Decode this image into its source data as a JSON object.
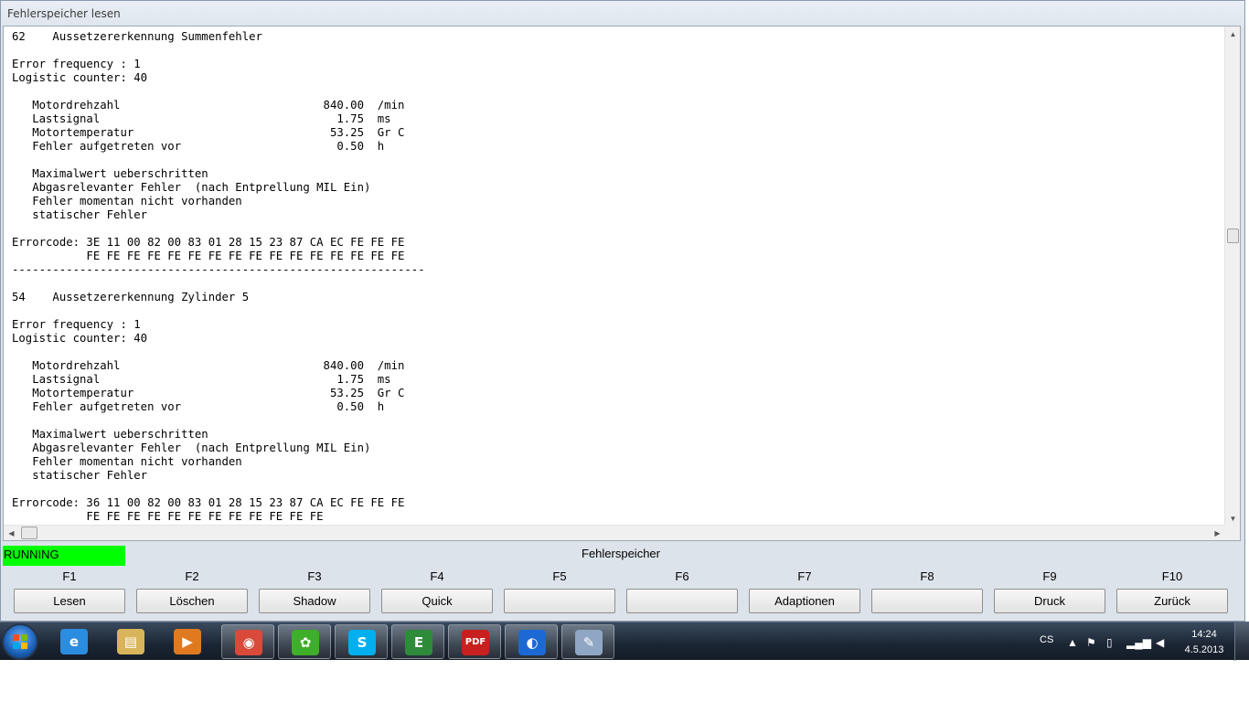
{
  "window": {
    "title": "Fehlerspeicher lesen"
  },
  "log_lines": [
    "62    Aussetzererkennung Summenfehler",
    "",
    "Error frequency : 1",
    "Logistic counter: 40",
    "",
    "   Motordrehzahl                              840.00  /min",
    "   Lastsignal                                   1.75  ms",
    "   Motortemperatur                             53.25  Gr C",
    "   Fehler aufgetreten vor                       0.50  h",
    "",
    "   Maximalwert ueberschritten",
    "   Abgasrelevanter Fehler  (nach Entprellung MIL Ein)",
    "   Fehler momentan nicht vorhanden",
    "   statischer Fehler",
    "",
    "Errorcode: 3E 11 00 82 00 83 01 28 15 23 87 CA EC FE FE FE",
    "           FE FE FE FE FE FE FE FE FE FE FE FE FE FE FE FE",
    "-------------------------------------------------------------",
    "",
    "54    Aussetzererkennung Zylinder 5",
    "",
    "Error frequency : 1",
    "Logistic counter: 40",
    "",
    "   Motordrehzahl                              840.00  /min",
    "   Lastsignal                                   1.75  ms",
    "   Motortemperatur                             53.25  Gr C",
    "   Fehler aufgetreten vor                       0.50  h",
    "",
    "   Maximalwert ueberschritten",
    "   Abgasrelevanter Fehler  (nach Entprellung MIL Ein)",
    "   Fehler momentan nicht vorhanden",
    "   statischer Fehler",
    "",
    "Errorcode: 36 11 00 82 00 83 01 28 15 23 87 CA EC FE FE FE",
    "           FE FE FE FE FE FE FE FE FE FE FE FE"
  ],
  "status": {
    "state": "RUNNING",
    "state_color": "#00ff00",
    "title": "Fehlerspeicher"
  },
  "function_keys": [
    {
      "key": "F1",
      "label": "Lesen"
    },
    {
      "key": "F2",
      "label": "Löschen"
    },
    {
      "key": "F3",
      "label": "Shadow"
    },
    {
      "key": "F4",
      "label": "Quick"
    },
    {
      "key": "F5",
      "label": ""
    },
    {
      "key": "F6",
      "label": ""
    },
    {
      "key": "F7",
      "label": "Adaptionen"
    },
    {
      "key": "F8",
      "label": ""
    },
    {
      "key": "F9",
      "label": "Druck"
    },
    {
      "key": "F10",
      "label": "Zurück"
    }
  ],
  "taskbar": {
    "apps": [
      {
        "name": "internet-explorer-icon",
        "glyph": "e",
        "color": "#2a8de0"
      },
      {
        "name": "file-explorer-icon",
        "glyph": "▤",
        "color": "#d8b45a"
      },
      {
        "name": "media-player-icon",
        "glyph": "▶",
        "color": "#e07a20"
      },
      {
        "name": "chrome-icon",
        "glyph": "◉",
        "color": "#d94a3a"
      },
      {
        "name": "icq-icon",
        "glyph": "✿",
        "color": "#3fae2a"
      },
      {
        "name": "skype-icon",
        "glyph": "S",
        "color": "#00aff0"
      },
      {
        "name": "ediabas-icon",
        "glyph": "E",
        "color": "#2e8b3a"
      },
      {
        "name": "pdf-icon",
        "glyph": "PDF",
        "color": "#c8201e"
      },
      {
        "name": "bmw-icon",
        "glyph": "◐",
        "color": "#1c69d4"
      },
      {
        "name": "paint-icon",
        "glyph": "✎",
        "color": "#8fa7c4"
      }
    ],
    "tray": {
      "language": "CS",
      "time": "14:24",
      "date": "4.5.2013"
    }
  }
}
